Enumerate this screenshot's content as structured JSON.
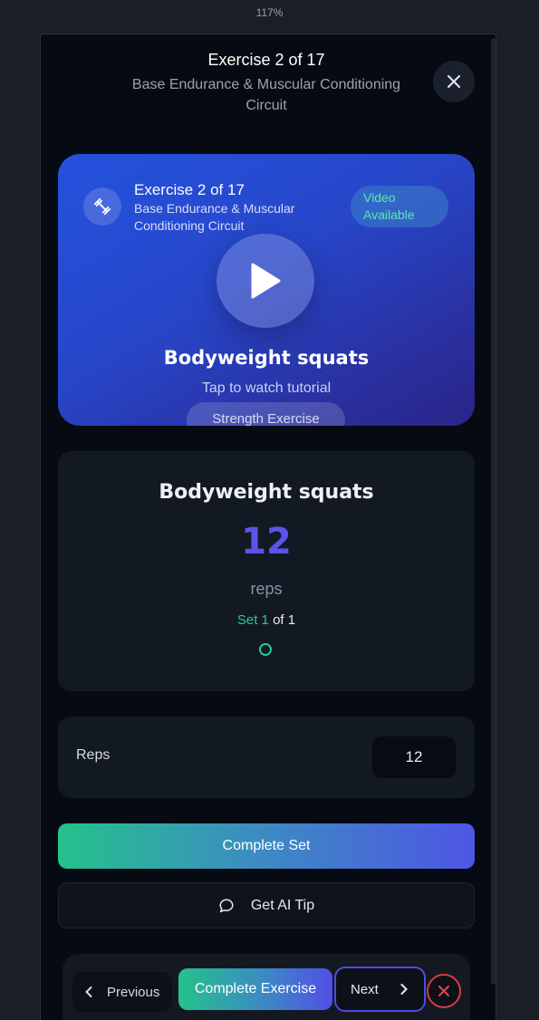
{
  "zoom_level": "117%",
  "header": {
    "title": "Exercise 2 of 17",
    "subtitle": "Base Endurance & Muscular Conditioning Circuit",
    "close_icon": "close-icon"
  },
  "video": {
    "icon": "dumbbell-icon",
    "title": "Exercise 2 of 17",
    "subtitle": "Base Endurance & Muscular Conditioning Circuit",
    "badge": "Video Available",
    "play_icon": "play-icon",
    "exercise_name": "Bodyweight squats",
    "tap_text": "Tap to watch tutorial",
    "category": "Strength Exercise"
  },
  "summary": {
    "exercise_name": "Bodyweight squats",
    "reps_value": "12",
    "reps_unit": "reps",
    "set_label": "Set 1",
    "set_of": "of 1"
  },
  "reps_input": {
    "label": "Reps",
    "value": "12"
  },
  "actions": {
    "complete_set": "Complete Set",
    "ai_tip": "Get AI Tip"
  },
  "footer": {
    "previous": "Previous",
    "complete_exercise": "Complete Exercise",
    "next": "Next"
  },
  "colors": {
    "accent_green": "#2ec790",
    "accent_indigo": "#5a55e8",
    "danger": "#d83a45",
    "background": "#1a1e26"
  }
}
